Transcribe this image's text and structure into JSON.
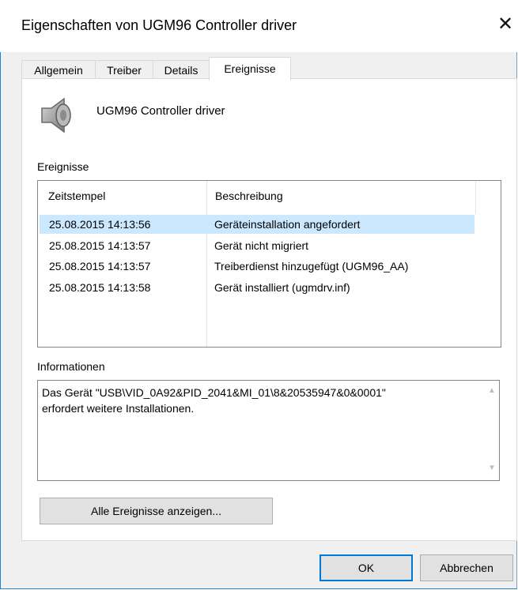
{
  "window": {
    "title": "Eigenschaften von UGM96 Controller driver"
  },
  "tabs": [
    {
      "label": "Allgemein"
    },
    {
      "label": "Treiber"
    },
    {
      "label": "Details"
    },
    {
      "label": "Ereignisse"
    }
  ],
  "active_tab": "Ereignisse",
  "device": {
    "name": "UGM96 Controller driver",
    "icon": "speaker-icon"
  },
  "events": {
    "label": "Ereignisse",
    "columns": [
      "Zeitstempel",
      "Beschreibung"
    ],
    "rows": [
      {
        "time": "25.08.2015 14:13:56",
        "desc": "Geräteinstallation angefordert"
      },
      {
        "time": "25.08.2015 14:13:57",
        "desc": "Gerät nicht migriert"
      },
      {
        "time": "25.08.2015 14:13:57",
        "desc": "Treiberdienst hinzugefügt (UGM96_AA)"
      },
      {
        "time": "25.08.2015 14:13:58",
        "desc": "Gerät installiert (ugmdrv.inf)"
      }
    ]
  },
  "info": {
    "label": "Informationen",
    "text": "Das Gerät \"USB\\VID_0A92&PID_2041&MI_01\\8&20535947&0&0001\"\nerfordert weitere Installationen."
  },
  "buttons": {
    "show_all": "Alle Ereignisse anzeigen...",
    "ok": "OK",
    "cancel": "Abbrechen"
  },
  "colors": {
    "selection": "#cce8ff",
    "accent": "#0078d7"
  }
}
